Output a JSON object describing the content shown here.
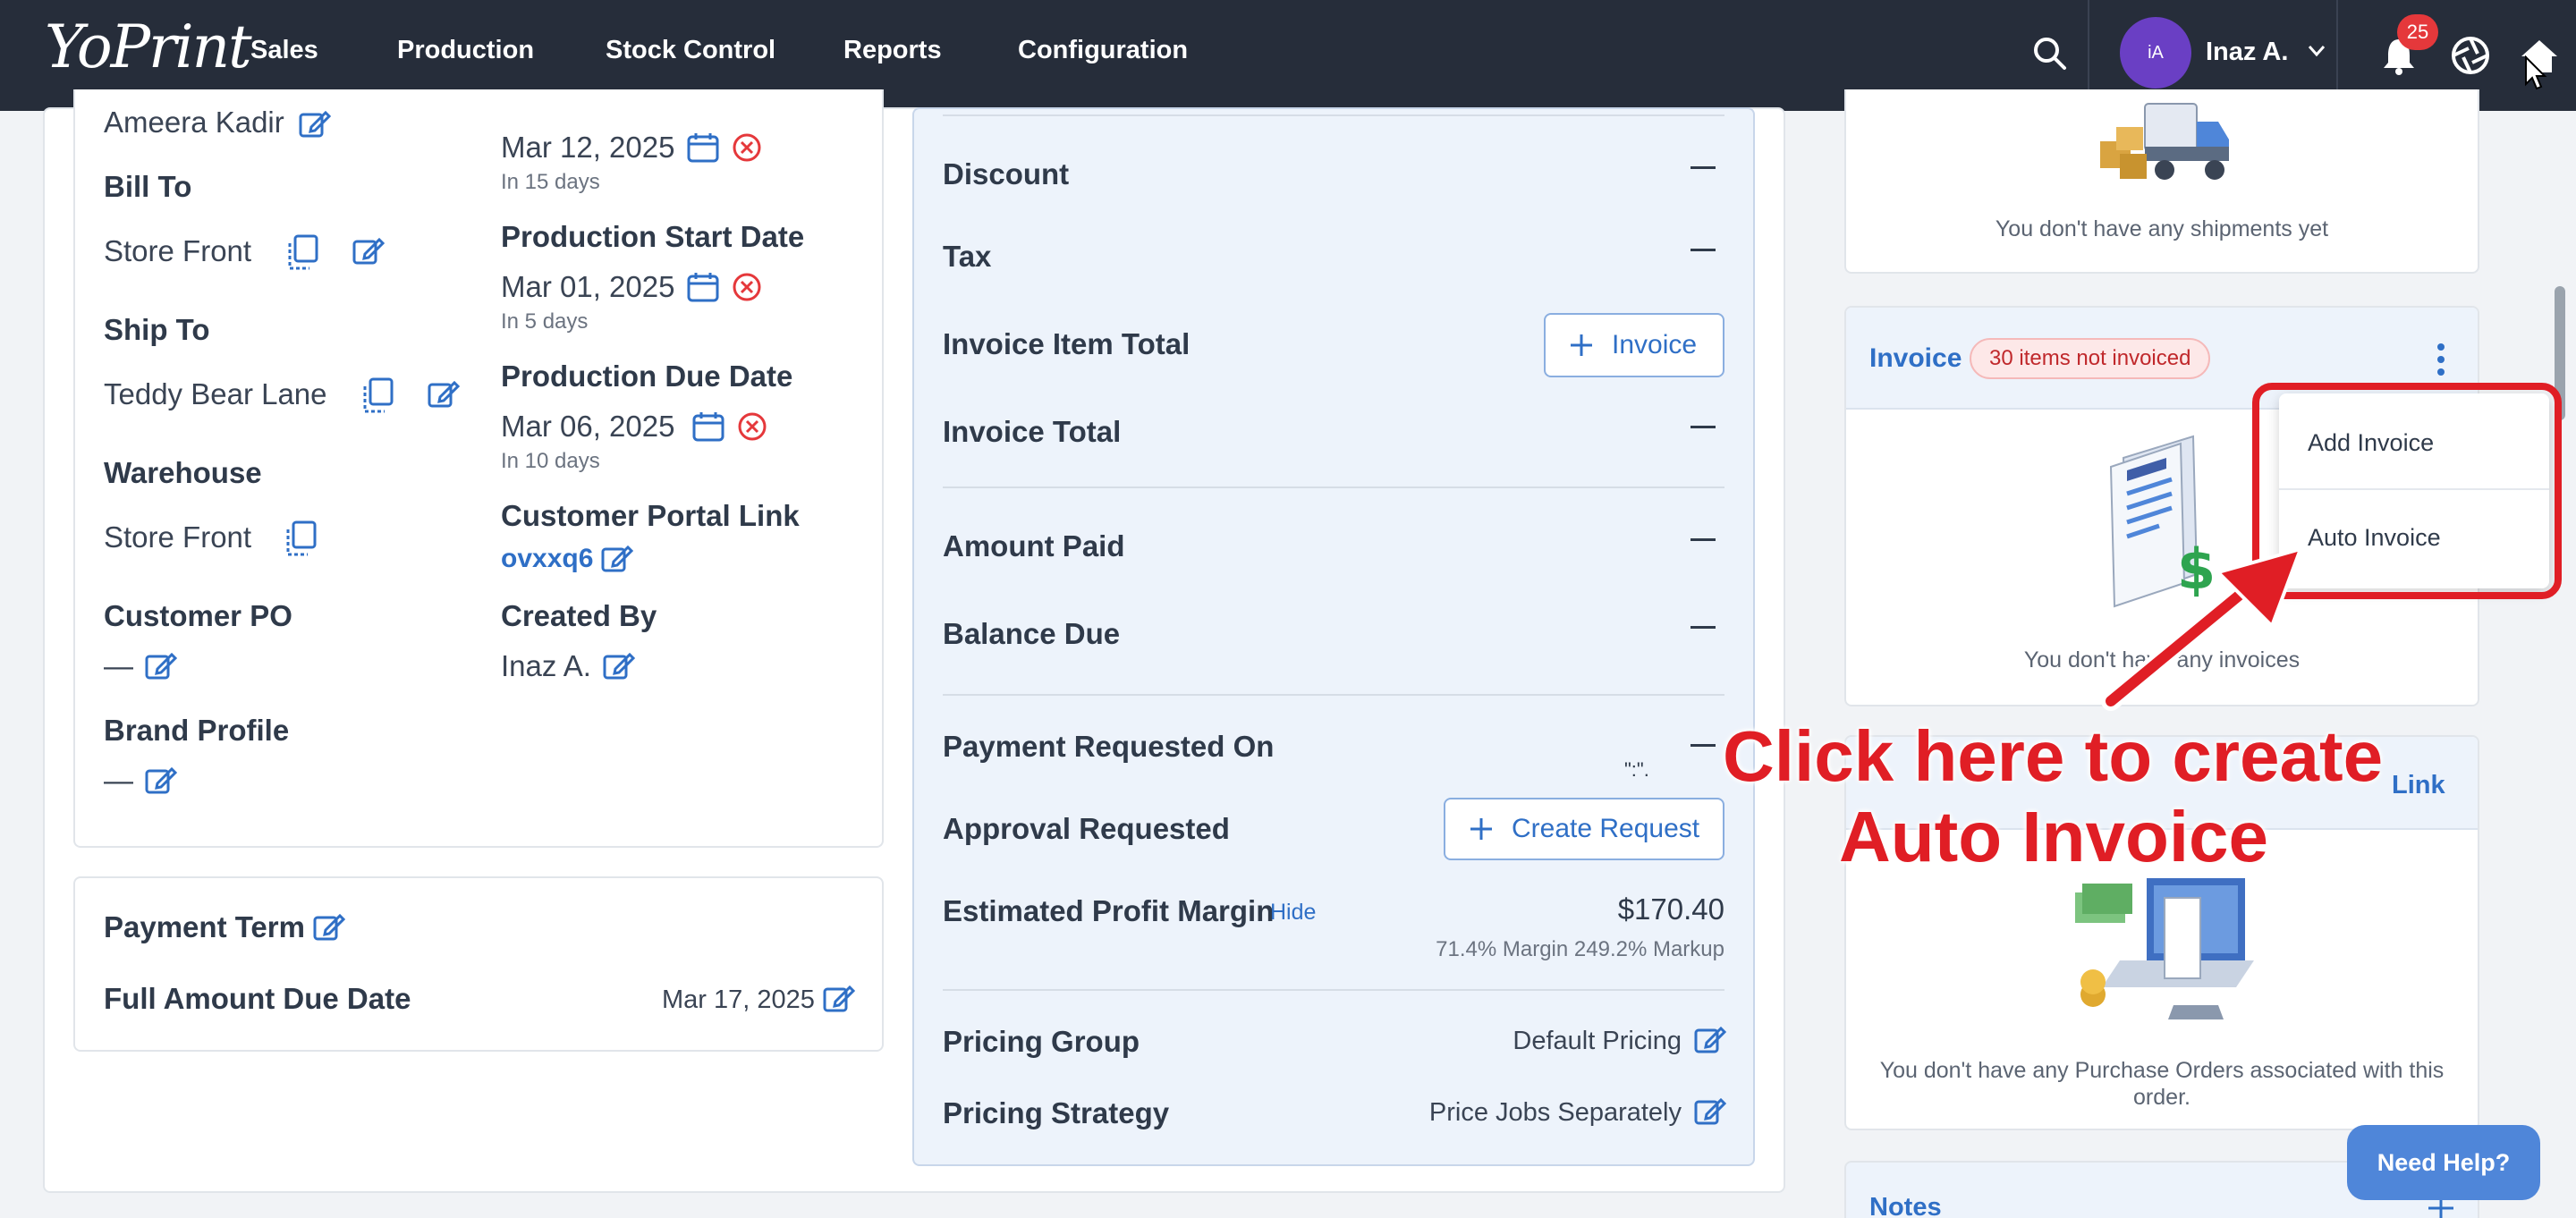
{
  "nav": {
    "logo": "YoPrint",
    "items": [
      "Sales",
      "Production",
      "Stock Control",
      "Reports",
      "Configuration"
    ],
    "user_initials": "iA",
    "user_name": "Inaz A.",
    "notification_count": "25"
  },
  "left": {
    "sales_rep": "Ameera Kadir",
    "bill_to_label": "Bill To",
    "bill_to_value": "Store Front",
    "ship_to_label": "Ship To",
    "ship_to_value": "Teddy Bear Lane",
    "warehouse_label": "Warehouse",
    "warehouse_value": "Store Front",
    "customer_po_label": "Customer PO",
    "customer_po_value": "—",
    "brand_profile_label": "Brand Profile",
    "brand_profile_value": "—",
    "date1_value": "Mar 12, 2025",
    "date1_sub": "In 15 days",
    "prod_start_label": "Production Start Date",
    "prod_start_value": "Mar 01, 2025",
    "prod_start_sub": "In 5 days",
    "prod_due_label": "Production Due Date",
    "prod_due_value": "Mar 06, 2025",
    "prod_due_sub": "In 10 days",
    "portal_label": "Customer Portal Link",
    "portal_value": "ovxxq6",
    "created_by_label": "Created By",
    "created_by_value": "Inaz A.",
    "payment_term_label": "Payment Term",
    "full_amount_label": "Full Amount Due Date",
    "full_amount_value": "Mar 17, 2025"
  },
  "middle": {
    "discount_label": "Discount",
    "tax_label": "Tax",
    "invoice_item_total_label": "Invoice Item Total",
    "invoice_button": "Invoice",
    "invoice_total_label": "Invoice Total",
    "amount_paid_label": "Amount Paid",
    "balance_due_label": "Balance Due",
    "payment_requested_label": "Payment Requested On",
    "approval_requested_label": "Approval Requested",
    "create_request_button": "Create Request",
    "profit_margin_label": "Estimated Profit Margin",
    "hide_link": "Hide",
    "profit_value": "$170.40",
    "margin_text": "71.4% Margin 249.2% Markup",
    "pricing_group_label": "Pricing Group",
    "pricing_group_value": "Default Pricing",
    "pricing_strategy_label": "Pricing Strategy",
    "pricing_strategy_value": "Price Jobs Separately",
    "stray_text": "\":\"."
  },
  "right": {
    "shipments_empty": "You don't have any shipments yet",
    "invoice_title": "Invoice",
    "invoice_badge": "30 items not invoiced",
    "invoice_empty": "You don't have any invoices",
    "menu_items": [
      "Add Invoice",
      "Auto Invoice"
    ],
    "po_link": "Link",
    "po_empty": "You don't have any Purchase Orders associated with this order.",
    "notes_title": "Notes"
  },
  "callout": {
    "line1": "Click here to create",
    "line2": "Auto Invoice"
  },
  "help_button": "Need Help?",
  "colors": {
    "navbar": "#262d3a",
    "accent": "#2f6fc6",
    "annotation": "#e01e25",
    "badge_bg": "#fde8e8"
  }
}
